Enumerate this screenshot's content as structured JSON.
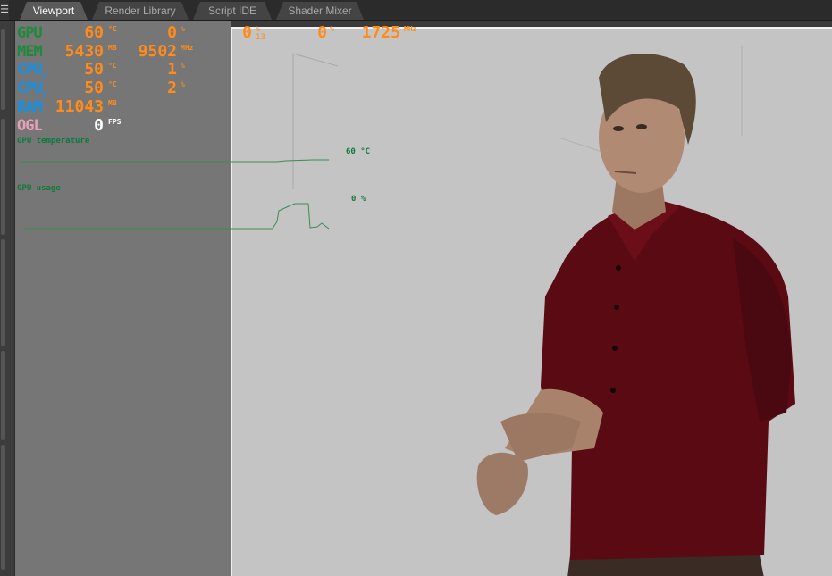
{
  "tabs": [
    {
      "label": "Viewport",
      "active": true
    },
    {
      "label": "Render Library",
      "active": false
    },
    {
      "label": "Script IDE",
      "active": false
    },
    {
      "label": "Shader Mixer",
      "active": false
    }
  ],
  "menu_glyph": "☰",
  "hud": {
    "gpu": {
      "label": "GPU",
      "temp": "60",
      "temp_unit": "°C",
      "usage": "0",
      "usage_unit": "%"
    },
    "mem": {
      "label": "MEM",
      "used": "5430",
      "used_unit": "MB",
      "clock": "9502",
      "clock_unit": "MHz"
    },
    "cpu1": {
      "label": "CPU",
      "sub": "1",
      "temp": "50",
      "temp_unit": "°C",
      "usage": "1",
      "usage_unit": "%"
    },
    "cpu2": {
      "label": "CPU",
      "sub": "2",
      "temp": "50",
      "temp_unit": "°C",
      "usage": "2",
      "usage_unit": "%"
    },
    "ram": {
      "label": "RAM",
      "value": "11043",
      "unit": "MB"
    },
    "ogl": {
      "label": "OGL",
      "value": "0",
      "unit": "FPS"
    },
    "top_row": {
      "v1": "0",
      "u1": "%",
      "sub": "13",
      "v2": "0",
      "u2": "%",
      "v3": "1725",
      "u3": "MHz"
    },
    "gpu_temp_graph": {
      "title": "GPU temperature",
      "current": "60 °C"
    },
    "gpu_usage_graph": {
      "title": "GPU usage",
      "current": "0 %"
    }
  },
  "colors": {
    "gpu_label": "#1f8a3b",
    "mem_label": "#1f8a3b",
    "cpu_label": "#1a8fe0",
    "ram_label": "#1a8fe0",
    "ogl_label": "#e8a0b8",
    "value": "#ff8c1a",
    "graph": "#3f8a52",
    "shirt": "#5a0a12",
    "skin": "#b08a73",
    "hair": "#5c4a37"
  }
}
